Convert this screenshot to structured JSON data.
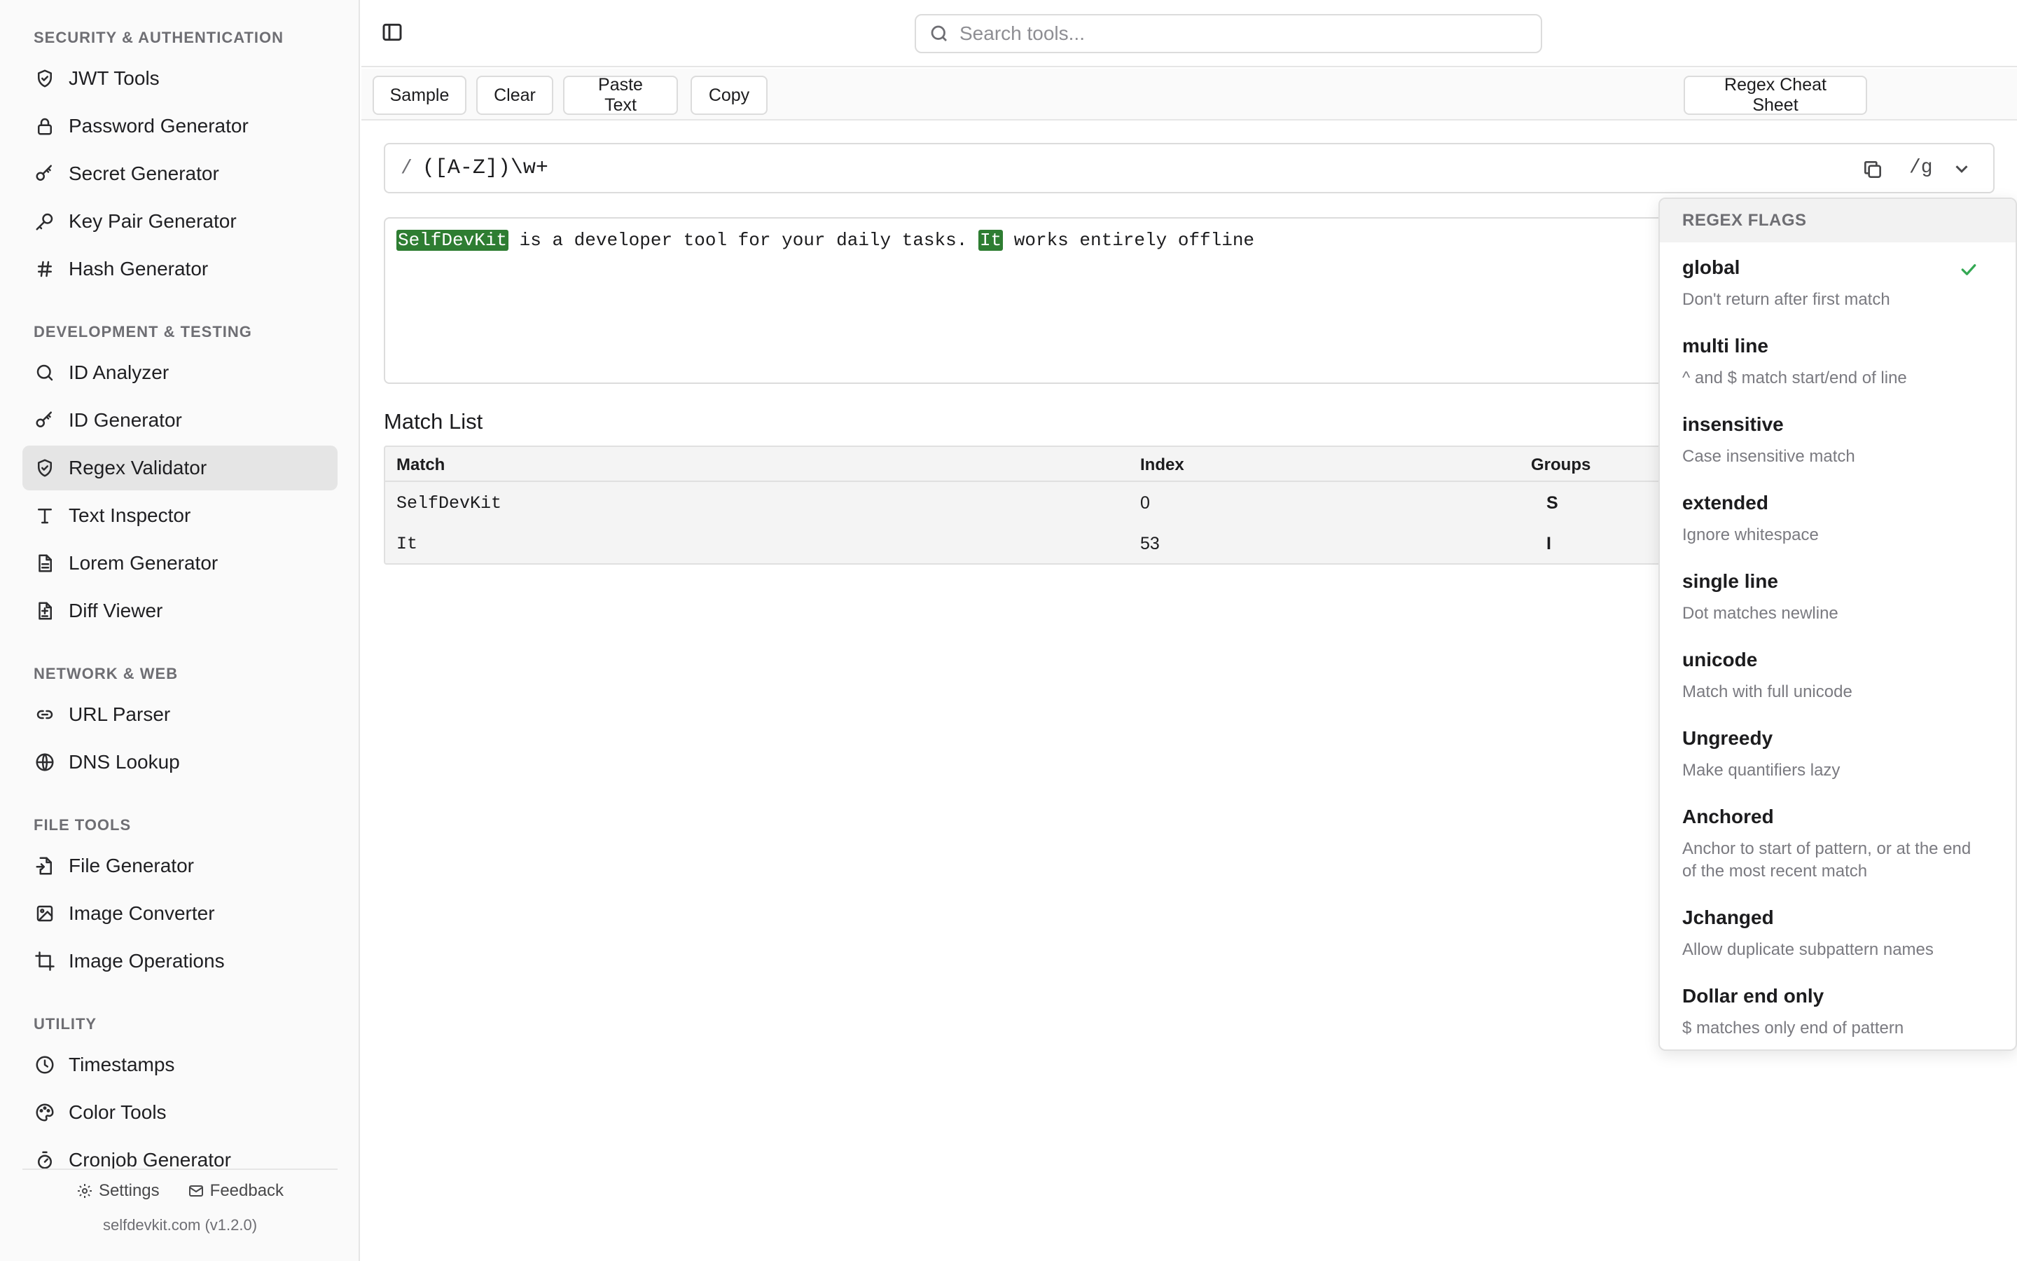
{
  "sidebar": {
    "groups": [
      {
        "title": "SECURITY & AUTHENTICATION",
        "items": [
          {
            "label": "JWT Tools",
            "icon": "shield-icon"
          },
          {
            "label": "Password Generator",
            "icon": "lock-icon"
          },
          {
            "label": "Secret Generator",
            "icon": "key-icon"
          },
          {
            "label": "Key Pair Generator",
            "icon": "key-round-icon"
          },
          {
            "label": "Hash Generator",
            "icon": "hash-icon"
          }
        ]
      },
      {
        "title": "DEVELOPMENT & TESTING",
        "items": [
          {
            "label": "ID Analyzer",
            "icon": "search-icon"
          },
          {
            "label": "ID Generator",
            "icon": "key-icon"
          },
          {
            "label": "Regex Validator",
            "icon": "shield-check-icon",
            "active": true
          },
          {
            "label": "Text Inspector",
            "icon": "type-icon"
          },
          {
            "label": "Lorem Generator",
            "icon": "file-text-icon"
          },
          {
            "label": "Diff Viewer",
            "icon": "file-diff-icon"
          }
        ]
      },
      {
        "title": "NETWORK & WEB",
        "items": [
          {
            "label": "URL Parser",
            "icon": "link-icon"
          },
          {
            "label": "DNS Lookup",
            "icon": "globe-icon"
          }
        ]
      },
      {
        "title": "FILE TOOLS",
        "items": [
          {
            "label": "File Generator",
            "icon": "file-input-icon"
          },
          {
            "label": "Image Converter",
            "icon": "image-icon"
          },
          {
            "label": "Image Operations",
            "icon": "crop-icon"
          }
        ]
      },
      {
        "title": "UTILITY",
        "items": [
          {
            "label": "Timestamps",
            "icon": "clock-icon"
          },
          {
            "label": "Color Tools",
            "icon": "palette-icon"
          },
          {
            "label": "Cronjob Generator",
            "icon": "timer-icon"
          }
        ]
      }
    ],
    "footer": {
      "settings": "Settings",
      "feedback": "Feedback",
      "version": "selfdevkit.com (v1.2.0)"
    }
  },
  "header": {
    "search_placeholder": "Search tools..."
  },
  "toolbar": {
    "sample": "Sample",
    "clear": "Clear",
    "paste": "Paste Text",
    "copy": "Copy",
    "cheat_sheet": "Regex Cheat Sheet"
  },
  "regex": {
    "slash": "/",
    "pattern": "([A-Z])\\w+",
    "flags": "/g"
  },
  "test_text": {
    "m1": "SelfDevKit",
    "t1": " is a developer tool for your daily tasks. ",
    "m2": "It",
    "t2": " works entirely offline"
  },
  "match_list": {
    "title": "Match List",
    "headers": {
      "match": "Match",
      "index": "Index",
      "groups": "Groups"
    },
    "rows": [
      {
        "match": "SelfDevKit",
        "index": "0",
        "group": "S"
      },
      {
        "match": "It",
        "index": "53",
        "group": "I"
      }
    ]
  },
  "flags_menu": {
    "title": "REGEX FLAGS",
    "items": [
      {
        "name": "global",
        "desc": "Don't return after first match",
        "checked": true
      },
      {
        "name": "multi line",
        "desc": "^ and $ match start/end of line"
      },
      {
        "name": "insensitive",
        "desc": "Case insensitive match"
      },
      {
        "name": "extended",
        "desc": "Ignore whitespace"
      },
      {
        "name": "single line",
        "desc": "Dot matches newline"
      },
      {
        "name": "unicode",
        "desc": "Match with full unicode"
      },
      {
        "name": "Ungreedy",
        "desc": "Make quantifiers lazy"
      },
      {
        "name": "Anchored",
        "desc": "Anchor to start of pattern, or at the end of the most recent match"
      },
      {
        "name": "Jchanged",
        "desc": "Allow duplicate subpattern names"
      },
      {
        "name": "Dollar end only",
        "desc": "$ matches only end of pattern"
      }
    ]
  },
  "colors": {
    "highlight": "#2e7d32",
    "active_nav": "#e5e5e5",
    "check": "#34a853"
  }
}
